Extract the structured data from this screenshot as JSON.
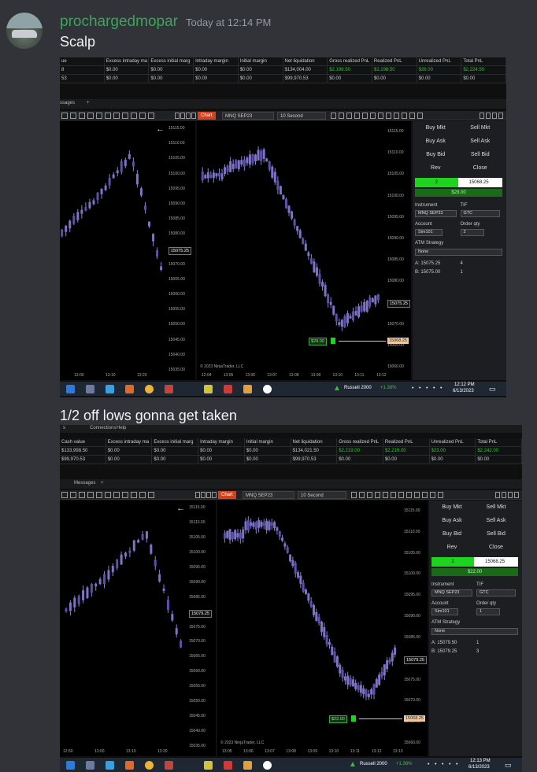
{
  "message": {
    "username": "prochargedmopar",
    "timestamp": "Today at 12:14 PM",
    "text1": "Scalp",
    "text2": "1/2 off lows gonna get taken"
  },
  "shot1": {
    "account_headers": [
      "ue",
      "Excess intraday ma",
      "Excess initial marg",
      "Intraday margin",
      "Initial margin",
      "Net liquidation",
      "Gross realized PnL",
      "Realized PnL",
      "Unrealized PnL",
      "Total PnL"
    ],
    "account_rows": [
      [
        "8",
        "$0.00",
        "$0.00",
        "$0.00",
        "$0.00",
        "$134,004.00",
        "$2,198.50",
        "$2,198.50",
        "$26.00",
        "$2,224.50"
      ],
      [
        "53",
        "$0.00",
        "$0.00",
        "$0.00",
        "$0.00",
        "$99,970.53",
        "$0.00",
        "$0.00",
        "$0.00",
        "$0.00"
      ]
    ],
    "tab_messages": "ssages",
    "tab_plus": "+",
    "chart_button": "Chart",
    "instrument_select": "MNQ SEP23",
    "interval_select": "10 Second",
    "left_axis": [
      "15115.00",
      "15110.00",
      "15105.00",
      "15100.00",
      "15095.00",
      "15090.00",
      "15085.00",
      "15080.00",
      "15075.25",
      "15070.00",
      "15065.00",
      "15060.00",
      "15055.00",
      "15050.00",
      "15045.00",
      "15040.00",
      "15035.00"
    ],
    "left_time": [
      "13:00",
      "13:10",
      "13:20"
    ],
    "right_axis": [
      "15115.00",
      "15110.00",
      "15105.00",
      "15100.00",
      "15095.00",
      "15090.00",
      "15085.00",
      "15080.00",
      "15075.25",
      "15070.00",
      "15065.00",
      "15060.00"
    ],
    "right_time": [
      "12:04",
      "13:05",
      "13:06",
      "13:07",
      "13:08",
      "13:09",
      "13:10",
      "13:11",
      "13:12"
    ],
    "price_tag": "15075.25",
    "entry_tag": "15068.25",
    "pos_tag": "$28.00",
    "copyright": "© 2023 NinjaTrader, LLC",
    "panel": {
      "buy_mkt": "Buy Mkt",
      "sell_mkt": "Sell Mkt",
      "buy_ask": "Buy Ask",
      "sell_ask": "Sell Ask",
      "buy_bid": "Buy Bid",
      "sell_bid": "Sell Bid",
      "rev": "Rev",
      "close": "Close",
      "qty": "2",
      "avg_price": "15068.25",
      "pnl": "$28.00",
      "instrument_label": "Instrument",
      "instrument": "MNQ SEP23",
      "tif_label": "TIF",
      "tif": "GTC",
      "account_label": "Account",
      "account": "Sim101",
      "order_qty_label": "Order qty",
      "order_qty": "2",
      "atm_label": "ATM Strategy",
      "atm": "None",
      "ask": "A: 15075.25",
      "ask_size": "4",
      "bid": "B: 15075.00",
      "bid_size": "1"
    },
    "taskbar": {
      "ticker": "Russell 2000",
      "change": "+1.36%",
      "time": "12:12 PM",
      "date": "6/13/2023"
    }
  },
  "shot2": {
    "menu": [
      "s",
      "Connections",
      "Help"
    ],
    "account_headers": [
      "Cash value",
      "Excess intraday ma",
      "Excess initial marg",
      "Intraday margin",
      "Initial margin",
      "Net liquidation",
      "Gross realized PnL",
      "Realized PnL",
      "Unrealized PnL",
      "Total PnL"
    ],
    "account_rows": [
      [
        "$133,998.50",
        "$0.00",
        "$0.00",
        "$0.00",
        "$0.00",
        "$134,021.50",
        "$2,219.00",
        "$2,219.00",
        "$23.00",
        "$2,242.00"
      ],
      [
        "$99,970.53",
        "$0.00",
        "$0.00",
        "$0.00",
        "$0.00",
        "$99,970.53",
        "$0.00",
        "$0.00",
        "$0.00",
        "$0.00"
      ]
    ],
    "tab_messages": "Messages",
    "tab_plus": "+",
    "chart_button": "Chart",
    "instrument_select": "MNQ SEP23",
    "interval_select": "10 Second",
    "left_axis": [
      "15115.00",
      "15110.00",
      "15105.00",
      "15100.00",
      "15095.00",
      "15090.00",
      "15085.00",
      "15079.25",
      "15075.00",
      "15070.00",
      "15065.00",
      "15060.00",
      "15055.00",
      "15050.00",
      "15045.00",
      "15040.00",
      "15035.00"
    ],
    "left_time": [
      "12:50",
      "13:00",
      "13:10",
      "13:20"
    ],
    "right_axis": [
      "15115.00",
      "15110.00",
      "15105.00",
      "15100.00",
      "15095.00",
      "15090.00",
      "15085.00",
      "15079.25",
      "15075.00",
      "15070.00",
      "15065.00",
      "15060.00"
    ],
    "right_time": [
      "13:05",
      "13:06",
      "13:07",
      "13:08",
      "13:09",
      "13:10",
      "13:11",
      "13:12",
      "13:13"
    ],
    "price_tag": "15079.25",
    "entry_tag": "15068.25",
    "pos_tag": "$22.00",
    "copyright": "© 2023 NinjaTrader, LLC",
    "panel": {
      "buy_mkt": "Buy Mkt",
      "sell_mkt": "Sell Mkt",
      "buy_ask": "Buy Ask",
      "sell_ask": "Sell Ask",
      "buy_bid": "Buy Bid",
      "sell_bid": "Sell Bid",
      "rev": "Rev",
      "close": "Close",
      "qty": "1",
      "avg_price": "15068.25",
      "pnl": "$22.00",
      "instrument_label": "Instrument",
      "instrument": "MNQ SEP23",
      "tif_label": "TIF",
      "tif": "GTC",
      "account_label": "Account",
      "account": "Sim101",
      "order_qty_label": "Order qty",
      "order_qty": "1",
      "atm_label": "ATM Strategy",
      "atm": "None",
      "ask": "A: 15079.50",
      "ask_size": "1",
      "bid": "B: 15079.25",
      "bid_size": "3"
    },
    "taskbar": {
      "ticker": "Russell 2000",
      "change": "+1.36%",
      "time": "12:13 PM",
      "date": "6/13/2023"
    }
  },
  "colors": {
    "username": "#3ba55c",
    "chart_button": "#d6401c",
    "candle": "#7d73c9",
    "pnl_green": "#1fd41f"
  }
}
